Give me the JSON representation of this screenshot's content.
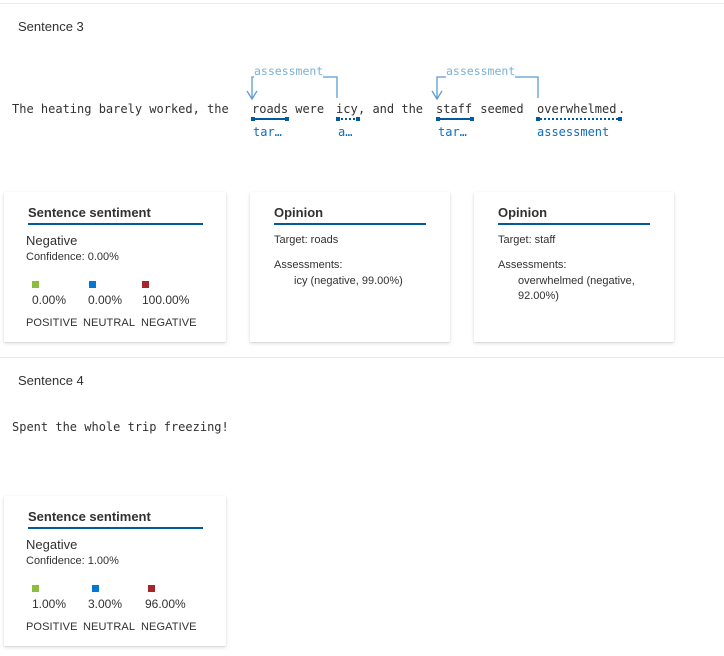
{
  "sections": [
    {
      "label": "Sentence 3",
      "tokens": [
        "The heating barely worked, the ",
        "roads",
        " were ",
        "icy",
        ", and the ",
        "staff",
        " seemed ",
        "overwhelmed",
        "."
      ],
      "arc_labels": [
        "assessment",
        "assessment"
      ],
      "below_labels": [
        "tar…",
        "a…",
        "tar…",
        "assessment"
      ],
      "sentiment_card": {
        "title": "Sentence sentiment",
        "label": "Negative",
        "confidence": "Confidence: 0.00%",
        "scores": [
          {
            "value": "0.00%",
            "caption": "POSITIVE",
            "color": "#8cbd3f"
          },
          {
            "value": "0.00%",
            "caption": "NEUTRAL",
            "color": "#0078d4"
          },
          {
            "value": "100.00%",
            "caption": "NEGATIVE",
            "color": "#a4262c"
          }
        ]
      },
      "opinions": [
        {
          "title": "Opinion",
          "target": "Target: roads",
          "assessments_label": "Assessments:",
          "assessment": "icy (negative, 99.00%)"
        },
        {
          "title": "Opinion",
          "target": "Target: staff",
          "assessments_label": "Assessments:",
          "assessment": "overwhelmed (negative, 92.00%)"
        }
      ]
    },
    {
      "label": "Sentence 4",
      "sentence": "Spent the whole trip freezing!",
      "sentiment_card": {
        "title": "Sentence sentiment",
        "label": "Negative",
        "confidence": "Confidence: 1.00%",
        "scores": [
          {
            "value": "1.00%",
            "caption": "POSITIVE",
            "color": "#8cbd3f"
          },
          {
            "value": "3.00%",
            "caption": "NEUTRAL",
            "color": "#0078d4"
          },
          {
            "value": "96.00%",
            "caption": "NEGATIVE",
            "color": "#a4262c"
          }
        ]
      }
    }
  ]
}
